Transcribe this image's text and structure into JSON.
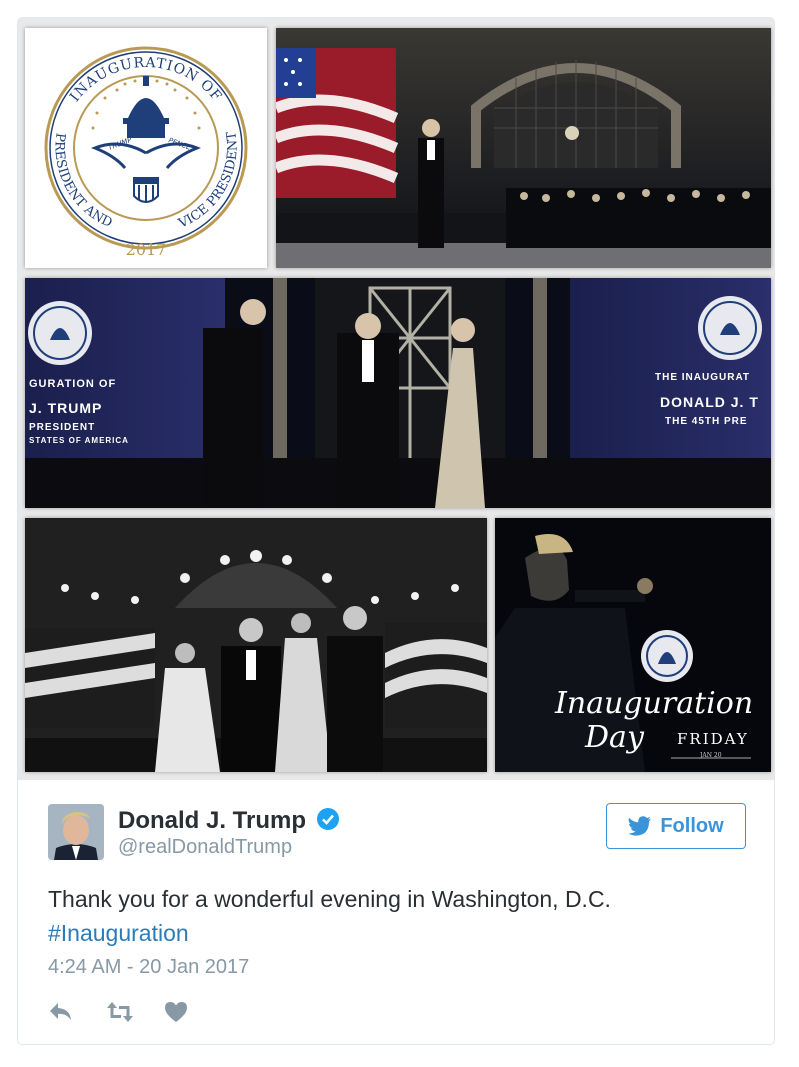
{
  "tweet": {
    "author_name": "Donald J. Trump",
    "author_handle": "@realDonaldTrump",
    "follow_label": "Follow",
    "text": "Thank you for a wonderful evening in Washington, D.C.",
    "hashtag": "#Inauguration",
    "timestamp": "4:24 AM - 20 Jan 2017"
  },
  "media": {
    "seal": {
      "ring_text_top": "INAUGURATION OF",
      "ring_text_left": "PRESIDENT AND",
      "ring_text_right": "VICE PRESIDENT",
      "year": "2017",
      "ribbon_left": "TRUMP",
      "ribbon_right": "PENCE"
    },
    "banner_left": {
      "line1": "GURATION OF",
      "line2": "J. TRUMP",
      "line3": "PRESIDENT",
      "line4": "STATES OF AMERICA"
    },
    "banner_right": {
      "line1": "THE INAUGURAT",
      "line2": "DONALD J. T",
      "line3": "THE 45TH PRE"
    },
    "promo": {
      "script_line1": "Inauguration",
      "script_line2": "Day",
      "day": "FRIDAY",
      "date": "JAN 20"
    }
  },
  "colors": {
    "link": "#2b7bb9",
    "follow": "#3b94d9",
    "verified": "#1da1f2",
    "muted": "#8899a6",
    "seal_blue": "#1f3f7a",
    "seal_gold": "#b99a55"
  },
  "icons": [
    "verified-badge-icon",
    "twitter-bird-icon",
    "reply-icon",
    "retweet-icon",
    "like-icon"
  ]
}
